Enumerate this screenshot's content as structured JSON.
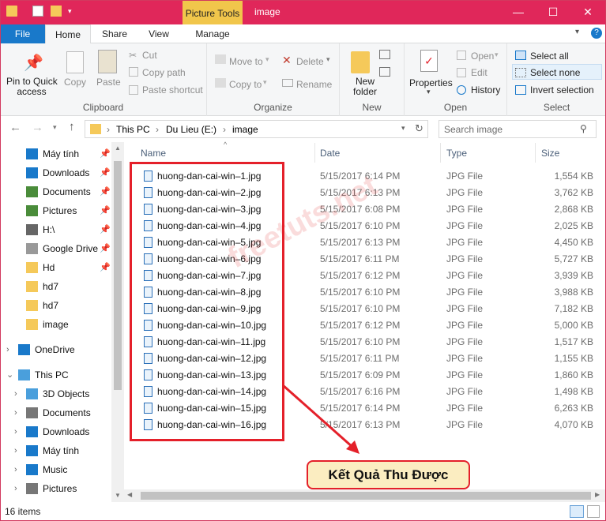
{
  "window": {
    "title": "image",
    "context_tab": "Picture Tools"
  },
  "tabs": [
    "File",
    "Home",
    "Share",
    "View",
    "Manage"
  ],
  "ribbon": {
    "clipboard": {
      "pin_line1": "Pin to Quick",
      "pin_line2": "access",
      "copy": "Copy",
      "paste": "Paste",
      "cut": "Cut",
      "copy_path": "Copy path",
      "paste_shortcut": "Paste shortcut",
      "label": "Clipboard"
    },
    "organize": {
      "move_to": "Move to",
      "copy_to": "Copy to",
      "delete": "Delete",
      "rename": "Rename",
      "label": "Organize"
    },
    "new": {
      "folder_line1": "New",
      "folder_line2": "folder",
      "label": "New"
    },
    "open": {
      "properties": "Properties",
      "open": "Open",
      "edit": "Edit",
      "history": "History",
      "label": "Open"
    },
    "select": {
      "select_all": "Select all",
      "select_none": "Select none",
      "invert": "Invert selection",
      "label": "Select"
    }
  },
  "address": {
    "crumbs": [
      "This PC",
      "Du Lieu (E:)",
      "image"
    ],
    "search_placeholder": "Search image"
  },
  "nav": [
    {
      "label": "Máy tính",
      "pin": true
    },
    {
      "label": "Downloads",
      "pin": true
    },
    {
      "label": "Documents",
      "pin": true
    },
    {
      "label": "Pictures",
      "pin": true
    },
    {
      "label": "H:\\",
      "pin": true
    },
    {
      "label": "Google Drive",
      "pin": true
    },
    {
      "label": "Hd",
      "pin": true
    },
    {
      "label": "hd7",
      "pin": false
    },
    {
      "label": "hd7",
      "pin": false
    },
    {
      "label": "image",
      "pin": false
    },
    {
      "label": "OneDrive",
      "pin": false
    },
    {
      "label": "This PC",
      "pin": false
    },
    {
      "label": "3D Objects",
      "pin": false
    },
    {
      "label": "Documents",
      "pin": false
    },
    {
      "label": "Downloads",
      "pin": false
    },
    {
      "label": "Máy tính",
      "pin": false
    },
    {
      "label": "Music",
      "pin": false
    },
    {
      "label": "Pictures",
      "pin": false
    }
  ],
  "columns": {
    "name": "Name",
    "date": "Date",
    "type": "Type",
    "size": "Size"
  },
  "files": [
    {
      "name": "huong-dan-cai-win–1.jpg",
      "date": "5/15/2017 6:14 PM",
      "type": "JPG File",
      "size": "1,554 KB"
    },
    {
      "name": "huong-dan-cai-win–2.jpg",
      "date": "5/15/2017 6:13 PM",
      "type": "JPG File",
      "size": "3,762 KB"
    },
    {
      "name": "huong-dan-cai-win–3.jpg",
      "date": "5/15/2017 6:08 PM",
      "type": "JPG File",
      "size": "2,868 KB"
    },
    {
      "name": "huong-dan-cai-win–4.jpg",
      "date": "5/15/2017 6:10 PM",
      "type": "JPG File",
      "size": "2,025 KB"
    },
    {
      "name": "huong-dan-cai-win–5.jpg",
      "date": "5/15/2017 6:13 PM",
      "type": "JPG File",
      "size": "4,450 KB"
    },
    {
      "name": "huong-dan-cai-win–6.jpg",
      "date": "5/15/2017 6:11 PM",
      "type": "JPG File",
      "size": "5,727 KB"
    },
    {
      "name": "huong-dan-cai-win–7.jpg",
      "date": "5/15/2017 6:12 PM",
      "type": "JPG File",
      "size": "3,939 KB"
    },
    {
      "name": "huong-dan-cai-win–8.jpg",
      "date": "5/15/2017 6:10 PM",
      "type": "JPG File",
      "size": "3,988 KB"
    },
    {
      "name": "huong-dan-cai-win–9.jpg",
      "date": "5/15/2017 6:10 PM",
      "type": "JPG File",
      "size": "7,182 KB"
    },
    {
      "name": "huong-dan-cai-win–10.jpg",
      "date": "5/15/2017 6:12 PM",
      "type": "JPG File",
      "size": "5,000 KB"
    },
    {
      "name": "huong-dan-cai-win–11.jpg",
      "date": "5/15/2017 6:10 PM",
      "type": "JPG File",
      "size": "1,517 KB"
    },
    {
      "name": "huong-dan-cai-win–12.jpg",
      "date": "5/15/2017 6:11 PM",
      "type": "JPG File",
      "size": "1,155 KB"
    },
    {
      "name": "huong-dan-cai-win–13.jpg",
      "date": "5/15/2017 6:09 PM",
      "type": "JPG File",
      "size": "1,860 KB"
    },
    {
      "name": "huong-dan-cai-win–14.jpg",
      "date": "5/15/2017 6:16 PM",
      "type": "JPG File",
      "size": "1,498 KB"
    },
    {
      "name": "huong-dan-cai-win–15.jpg",
      "date": "5/15/2017 6:14 PM",
      "type": "JPG File",
      "size": "6,263 KB"
    },
    {
      "name": "huong-dan-cai-win–16.jpg",
      "date": "5/15/2017 6:13 PM",
      "type": "JPG File",
      "size": "4,070 KB"
    }
  ],
  "status": {
    "count": "16 items"
  },
  "annotation": {
    "callout": "Kết Quả Thu Được",
    "watermark": "freetuts.net"
  },
  "colors": {
    "titlebar": "#e0275a",
    "file_tab": "#1979ca",
    "context_tab": "#f1c64b",
    "highlight": "#e4202a"
  }
}
